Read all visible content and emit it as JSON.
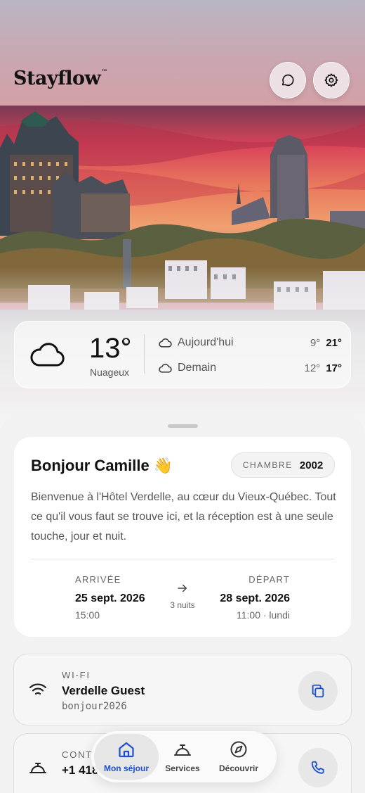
{
  "header": {
    "brand": "Stayflow",
    "brand_mark": "™",
    "chat_icon": "chat-bubble-icon",
    "settings_icon": "gear-icon"
  },
  "weather": {
    "temperature": "13°",
    "unit": "C",
    "condition": "Nuageux",
    "icon": "cloud-icon",
    "forecast": [
      {
        "label": "Aujourd'hui",
        "low": "9°",
        "high": "21°"
      },
      {
        "label": "Demain",
        "low": "12°",
        "high": "17°"
      }
    ]
  },
  "welcome_card": {
    "greeting": "Bonjour Camille 👋",
    "room_label": "CHAMBRE",
    "room_number": "2002",
    "message": "Bienvenue à l'Hôtel Verdelle, au cœur du Vieux-Québec. Tout ce qu'il vous faut se trouve ici, et la réception est à une seule touche, jour et nuit.",
    "arrival": {
      "label": "ARRIVÉE",
      "date": "25 sept. 2026",
      "time": "15:00"
    },
    "nights": "3 nuits",
    "departure": {
      "label": "DÉPART",
      "date": "28 sept. 2026",
      "time": "11:00 · lundi"
    }
  },
  "wifi": {
    "label": "WI-FI",
    "network": "Verdelle Guest",
    "password": "bonjour2026",
    "icon": "wifi-icon",
    "action_icon": "copy-icon"
  },
  "contact": {
    "label": "CONT",
    "phone": "+1 418 555 0148",
    "icon": "reception-bell-icon",
    "action_icon": "phone-icon"
  },
  "tabs": [
    {
      "label": "Mon séjour",
      "icon": "home-icon",
      "active": true
    },
    {
      "label": "Services",
      "icon": "service-bell-icon",
      "active": false
    },
    {
      "label": "Découvrir",
      "icon": "compass-icon",
      "active": false
    }
  ],
  "colors": {
    "accent": "#1f4fd1",
    "sky": "#e0576a"
  }
}
